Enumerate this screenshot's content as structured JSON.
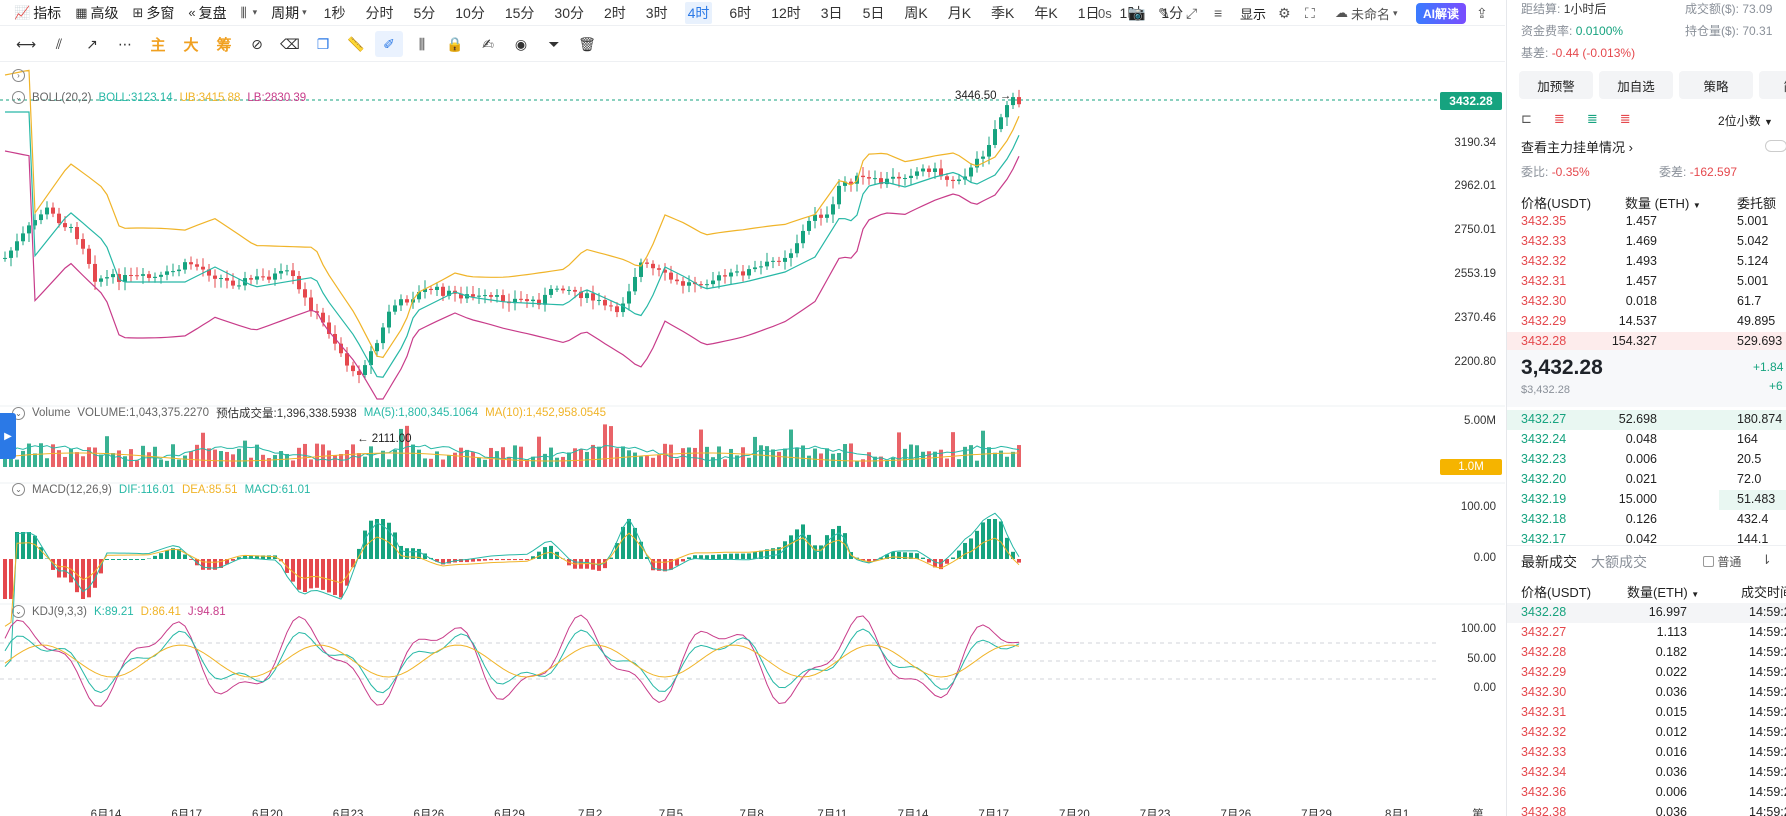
{
  "toolbar": {
    "tools": [
      {
        "icon": "chart-line-icon",
        "label": "指标"
      },
      {
        "icon": "calendar-icon",
        "label": "高级"
      },
      {
        "icon": "grid-icon",
        "label": "多窗"
      },
      {
        "icon": "rewind-icon",
        "label": "复盘"
      }
    ],
    "period_label": "周期",
    "periods": [
      "1秒",
      "分时",
      "5分",
      "10分",
      "15分",
      "30分",
      "2时",
      "3时",
      "4时",
      "6时",
      "12时",
      "3日",
      "5日",
      "周K",
      "月K",
      "季K",
      "年K",
      "1日",
      "1时",
      "1分"
    ],
    "active_period": "4时",
    "right": {
      "latency": "0s",
      "display_label": "显示",
      "layout_name": "未命名",
      "ai_label": "AI解读"
    }
  },
  "chart": {
    "boll_legend": {
      "name": "BOLL(20,2)",
      "boll": "BOLL:3123.14",
      "ub": "UB:3415.88",
      "lb": "LB:2830.39"
    },
    "volume_legend": {
      "name": "Volume",
      "volume": "VOLUME:1,043,375.2270",
      "estimate": "预估成交量:1,396,338.5938",
      "ma5": "MA(5):1,800,345.1064",
      "ma10": "MA(10):1,452,958.0545"
    },
    "macd_legend": {
      "name": "MACD(12,26,9)",
      "dif": "DIF:116.01",
      "dea": "DEA:85.51",
      "macd": "MACD:61.01"
    },
    "kdj_legend": {
      "name": "KDJ(9,3,3)",
      "k": "K:89.21",
      "d": "D:86.41",
      "j": "J:94.81"
    },
    "price_axis": [
      "3190.34",
      "2962.01",
      "2750.01",
      "2553.19",
      "2370.46",
      "2200.80"
    ],
    "current_price": "3432.28",
    "high_label": "3446.50 →",
    "low_label": "← 2111.00",
    "volume_axis": "5.00M",
    "volume_tag": "1.0M",
    "macd_axis": [
      "100.00",
      "0.00"
    ],
    "kdj_axis": [
      "100.00",
      "50.00",
      "0.00"
    ],
    "date_axis": [
      "6月14",
      "6月17",
      "6月20",
      "6月23",
      "6月26",
      "6月29",
      "7月2",
      "7月5",
      "7月8",
      "7月11",
      "7月14",
      "7月17",
      "7月20",
      "7月23",
      "7月26",
      "7月29",
      "8月1",
      "第"
    ],
    "colors": {
      "up": "#16a37f",
      "down": "#e5484d",
      "boll_mid": "#27b8a6",
      "boll_ub": "#f0b429",
      "boll_lb": "#c83c8a"
    }
  },
  "panel": {
    "settle": {
      "label": "距结算:",
      "value": "1小时后"
    },
    "turnover": "成交额($): 73.09",
    "funding": {
      "label": "资金费率:",
      "value": "0.0100%"
    },
    "open_interest": "持仓量($): 70.31",
    "basis": {
      "label": "基差:",
      "value": "-0.44 (-0.013%)"
    },
    "buttons": [
      "加预警",
      "加自选",
      "策略",
      "简况"
    ],
    "decimals": "2位小数",
    "order_link": "查看主力挂单情况",
    "ratio": {
      "label": "委比:",
      "value": "-0.35%"
    },
    "diff": {
      "label": "委差:",
      "value": "-162.597"
    },
    "ob_headers": [
      "价格(USDT)",
      "数量 (ETH)",
      "委托额"
    ],
    "asks": [
      {
        "price": "3432.35",
        "qty": "1.457",
        "amt": "5.001"
      },
      {
        "price": "3432.33",
        "qty": "1.469",
        "amt": "5.042"
      },
      {
        "price": "3432.32",
        "qty": "1.493",
        "amt": "5.124"
      },
      {
        "price": "3432.31",
        "qty": "1.457",
        "amt": "5.001"
      },
      {
        "price": "3432.30",
        "qty": "0.018",
        "amt": "61.7"
      },
      {
        "price": "3432.29",
        "qty": "14.537",
        "amt": "49.895"
      },
      {
        "price": "3432.28",
        "qty": "154.327",
        "amt": "529.693"
      }
    ],
    "last_price": "3,432.28",
    "last_price_usd": "$3,432.28",
    "change_1": "+1.84",
    "change_2": "+6",
    "bids": [
      {
        "price": "3432.27",
        "qty": "52.698",
        "amt": "180.874"
      },
      {
        "price": "3432.24",
        "qty": "0.048",
        "amt": "164"
      },
      {
        "price": "3432.23",
        "qty": "0.006",
        "amt": "20.5"
      },
      {
        "price": "3432.20",
        "qty": "0.021",
        "amt": "72.0"
      },
      {
        "price": "3432.19",
        "qty": "15.000",
        "amt": "51.483"
      },
      {
        "price": "3432.18",
        "qty": "0.126",
        "amt": "432.4"
      },
      {
        "price": "3432.17",
        "qty": "0.042",
        "amt": "144.1"
      }
    ],
    "trade_tabs": [
      "最新成交",
      "大额成交"
    ],
    "trade_toggle": "普通",
    "trade_headers": [
      "价格(USDT)",
      "数量(ETH)",
      "成交时间"
    ],
    "trades": [
      {
        "price": "3432.28",
        "qty": "16.997",
        "time": "14:59:2",
        "side": "buy"
      },
      {
        "price": "3432.27",
        "qty": "1.113",
        "time": "14:59:2",
        "side": "sell"
      },
      {
        "price": "3432.28",
        "qty": "0.182",
        "time": "14:59:2",
        "side": "sell"
      },
      {
        "price": "3432.29",
        "qty": "0.022",
        "time": "14:59:2",
        "side": "sell"
      },
      {
        "price": "3432.30",
        "qty": "0.036",
        "time": "14:59:2",
        "side": "sell"
      },
      {
        "price": "3432.31",
        "qty": "0.015",
        "time": "14:59:2",
        "side": "sell"
      },
      {
        "price": "3432.32",
        "qty": "0.012",
        "time": "14:59:2",
        "side": "sell"
      },
      {
        "price": "3432.33",
        "qty": "0.016",
        "time": "14:59:2",
        "side": "sell"
      },
      {
        "price": "3432.34",
        "qty": "0.036",
        "time": "14:59:2",
        "side": "sell"
      },
      {
        "price": "3432.36",
        "qty": "0.006",
        "time": "14:59:2",
        "side": "sell"
      },
      {
        "price": "3432.38",
        "qty": "0.036",
        "time": "14:59:2",
        "side": "sell"
      }
    ]
  }
}
